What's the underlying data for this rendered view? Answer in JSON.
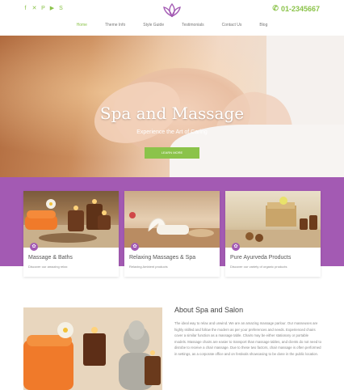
{
  "header": {
    "social_icons": [
      "facebook-icon",
      "twitter-icon",
      "pinterest-icon",
      "youtube-icon",
      "skype-icon"
    ],
    "logo_icon": "lotus-logo-icon",
    "phone": "01-2345667",
    "accent_color": "#8bc34a",
    "brand_purple": "#a35ab3"
  },
  "nav": {
    "items": [
      "Home",
      "Theme Info",
      "Style Guide",
      "Testimonials",
      "Contact Us",
      "Blog"
    ],
    "active": "Home"
  },
  "hero": {
    "title": "Spa and Massage",
    "subtitle": "Experience the Art of Caring",
    "button_label": "LEARN MORE"
  },
  "cards": [
    {
      "title": "Massage & Baths",
      "text": "Discover our amazing relax"
    },
    {
      "title": "Relaxing Massages & Spa",
      "text": "Relaxing Ambient products"
    },
    {
      "title": "Pure Ayurveda Products",
      "text": "Discover our variety of organic products"
    }
  ],
  "about": {
    "title": "About Spa and Salon",
    "text": "The ideal way to relax and unwind. We are an amazing massage parlour. Our masseuses are highly skilled and follow the modern as per your preferences and needs. Experienced chairs cover a similar function as a massage table. Chairs may be either stationary or portable models. Massage chairs are easier to transport than massage tables, and clients do not need to disrobe to receive a chair massage. Due to these two factors, chair massage is often performed in settings, as a corporate office and on festivals showcasing to be done in the public location."
  }
}
